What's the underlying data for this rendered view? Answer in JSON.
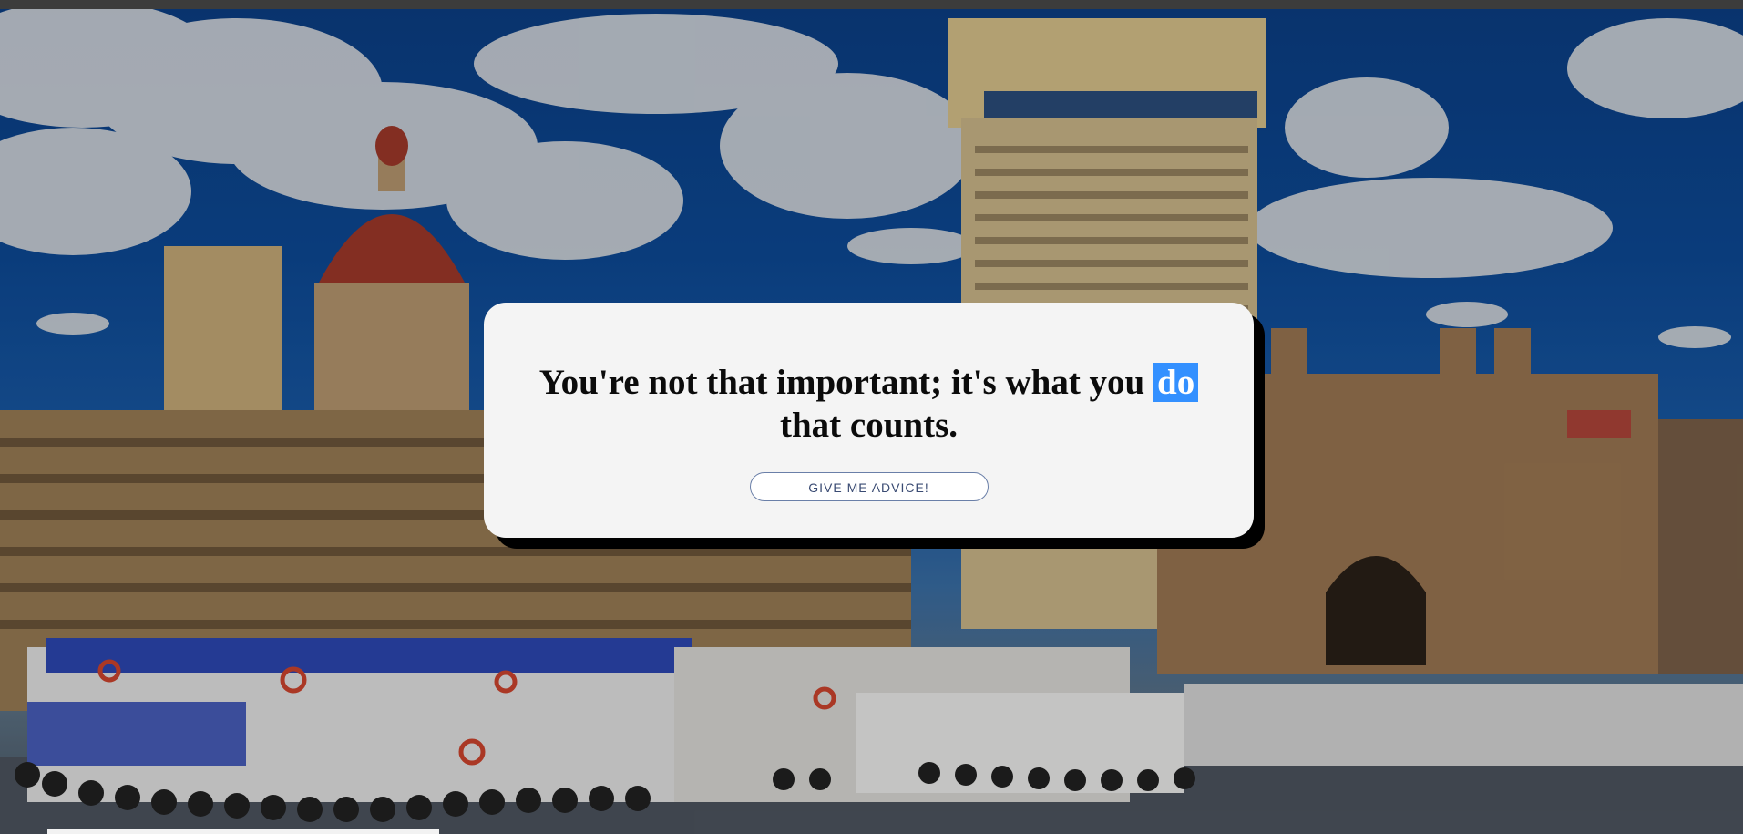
{
  "background": {
    "description_icon": "mumbai-skyline-image",
    "sky_color": "#0d4a97"
  },
  "quote": {
    "text_before": "You're not that important; it's what you ",
    "highlighted_word": "do",
    "text_after": " that counts."
  },
  "button": {
    "label": "GIVE ME ADVICE!"
  },
  "colors": {
    "card_background": "#f4f4f4",
    "card_shadow": "#000000",
    "selection_highlight": "#3390ff",
    "button_border": "#6a7fa8",
    "button_text": "#3a4b73"
  }
}
